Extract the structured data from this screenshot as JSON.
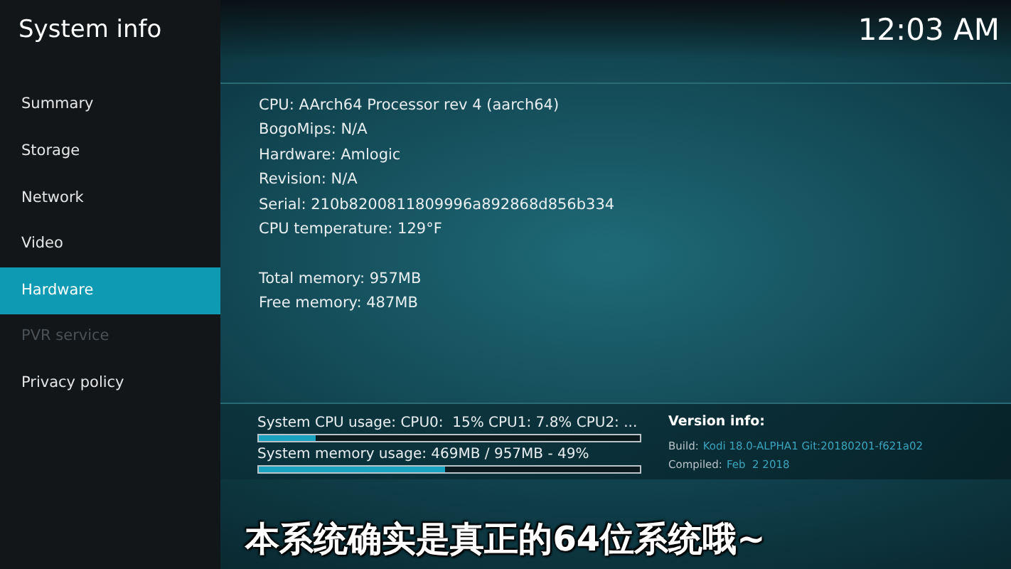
{
  "window": {
    "title": "System info",
    "clock": "12:03 AM"
  },
  "sidebar": {
    "items": [
      {
        "label": "Summary",
        "selected": false,
        "disabled": false
      },
      {
        "label": "Storage",
        "selected": false,
        "disabled": false
      },
      {
        "label": "Network",
        "selected": false,
        "disabled": false
      },
      {
        "label": "Video",
        "selected": false,
        "disabled": false
      },
      {
        "label": "Hardware",
        "selected": true,
        "disabled": false
      },
      {
        "label": "PVR service",
        "selected": false,
        "disabled": true
      },
      {
        "label": "Privacy policy",
        "selected": false,
        "disabled": false
      }
    ]
  },
  "info_groups": [
    [
      "CPU: AArch64 Processor rev 4 (aarch64)",
      "BogoMips: N/A",
      "Hardware: Amlogic",
      "Revision: N/A",
      "Serial: 210b8200811809996a892868d856b334",
      "CPU temperature: 129°F"
    ],
    [
      "Total memory: 957MB",
      "Free memory: 487MB"
    ]
  ],
  "usage": [
    {
      "label": "System CPU usage: CPU0:  15% CPU1: 7.8% CPU2: ...",
      "level": 0.15
    },
    {
      "label": "System memory usage: 469MB / 957MB - 49%",
      "level": 0.49
    }
  ],
  "version": {
    "title": "Version info:",
    "rows": [
      {
        "key": "Build:",
        "value": "Kodi 18.0-ALPHA1 Git:20180201-f621a02"
      },
      {
        "key": "Compiled:",
        "value": "Feb  2 2018"
      }
    ]
  },
  "subtitle": "本系统确实是真正的64位系统哦~"
}
